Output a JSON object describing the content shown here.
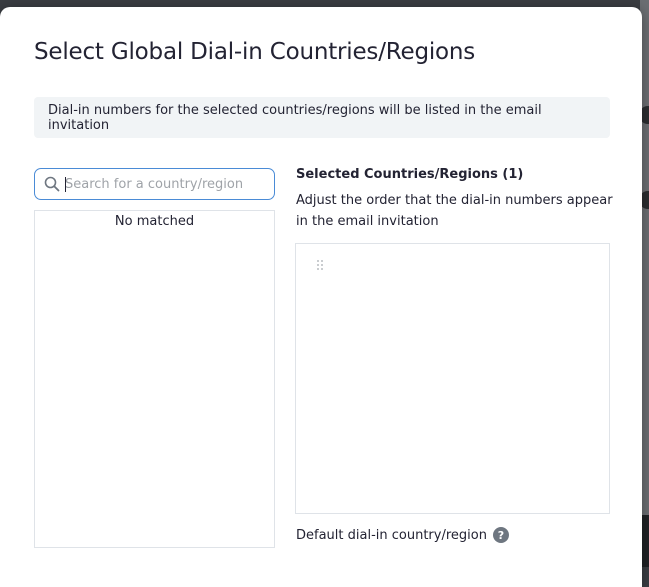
{
  "modal": {
    "title": "Select Global Dial-in Countries/Regions",
    "info_banner": "Dial-in numbers for the selected countries/regions will be listed in the email invitation"
  },
  "search": {
    "placeholder": "Search for a country/region",
    "value": "",
    "icon": "search-icon"
  },
  "country_list": {
    "empty_text": "No matched"
  },
  "selected": {
    "title": "Selected Countries/Regions (1)",
    "description": "Adjust the order that the dial-in numbers appear in the email invitation",
    "drag_icon": "drag-handle-icon"
  },
  "default_country": {
    "label": "Default dial-in country/region",
    "help_glyph": "?"
  },
  "colors": {
    "focus_border": "#4a8bd6",
    "text": "#232333",
    "banner_bg": "#f1f4f6",
    "help_icon_bg": "#6e7680"
  }
}
